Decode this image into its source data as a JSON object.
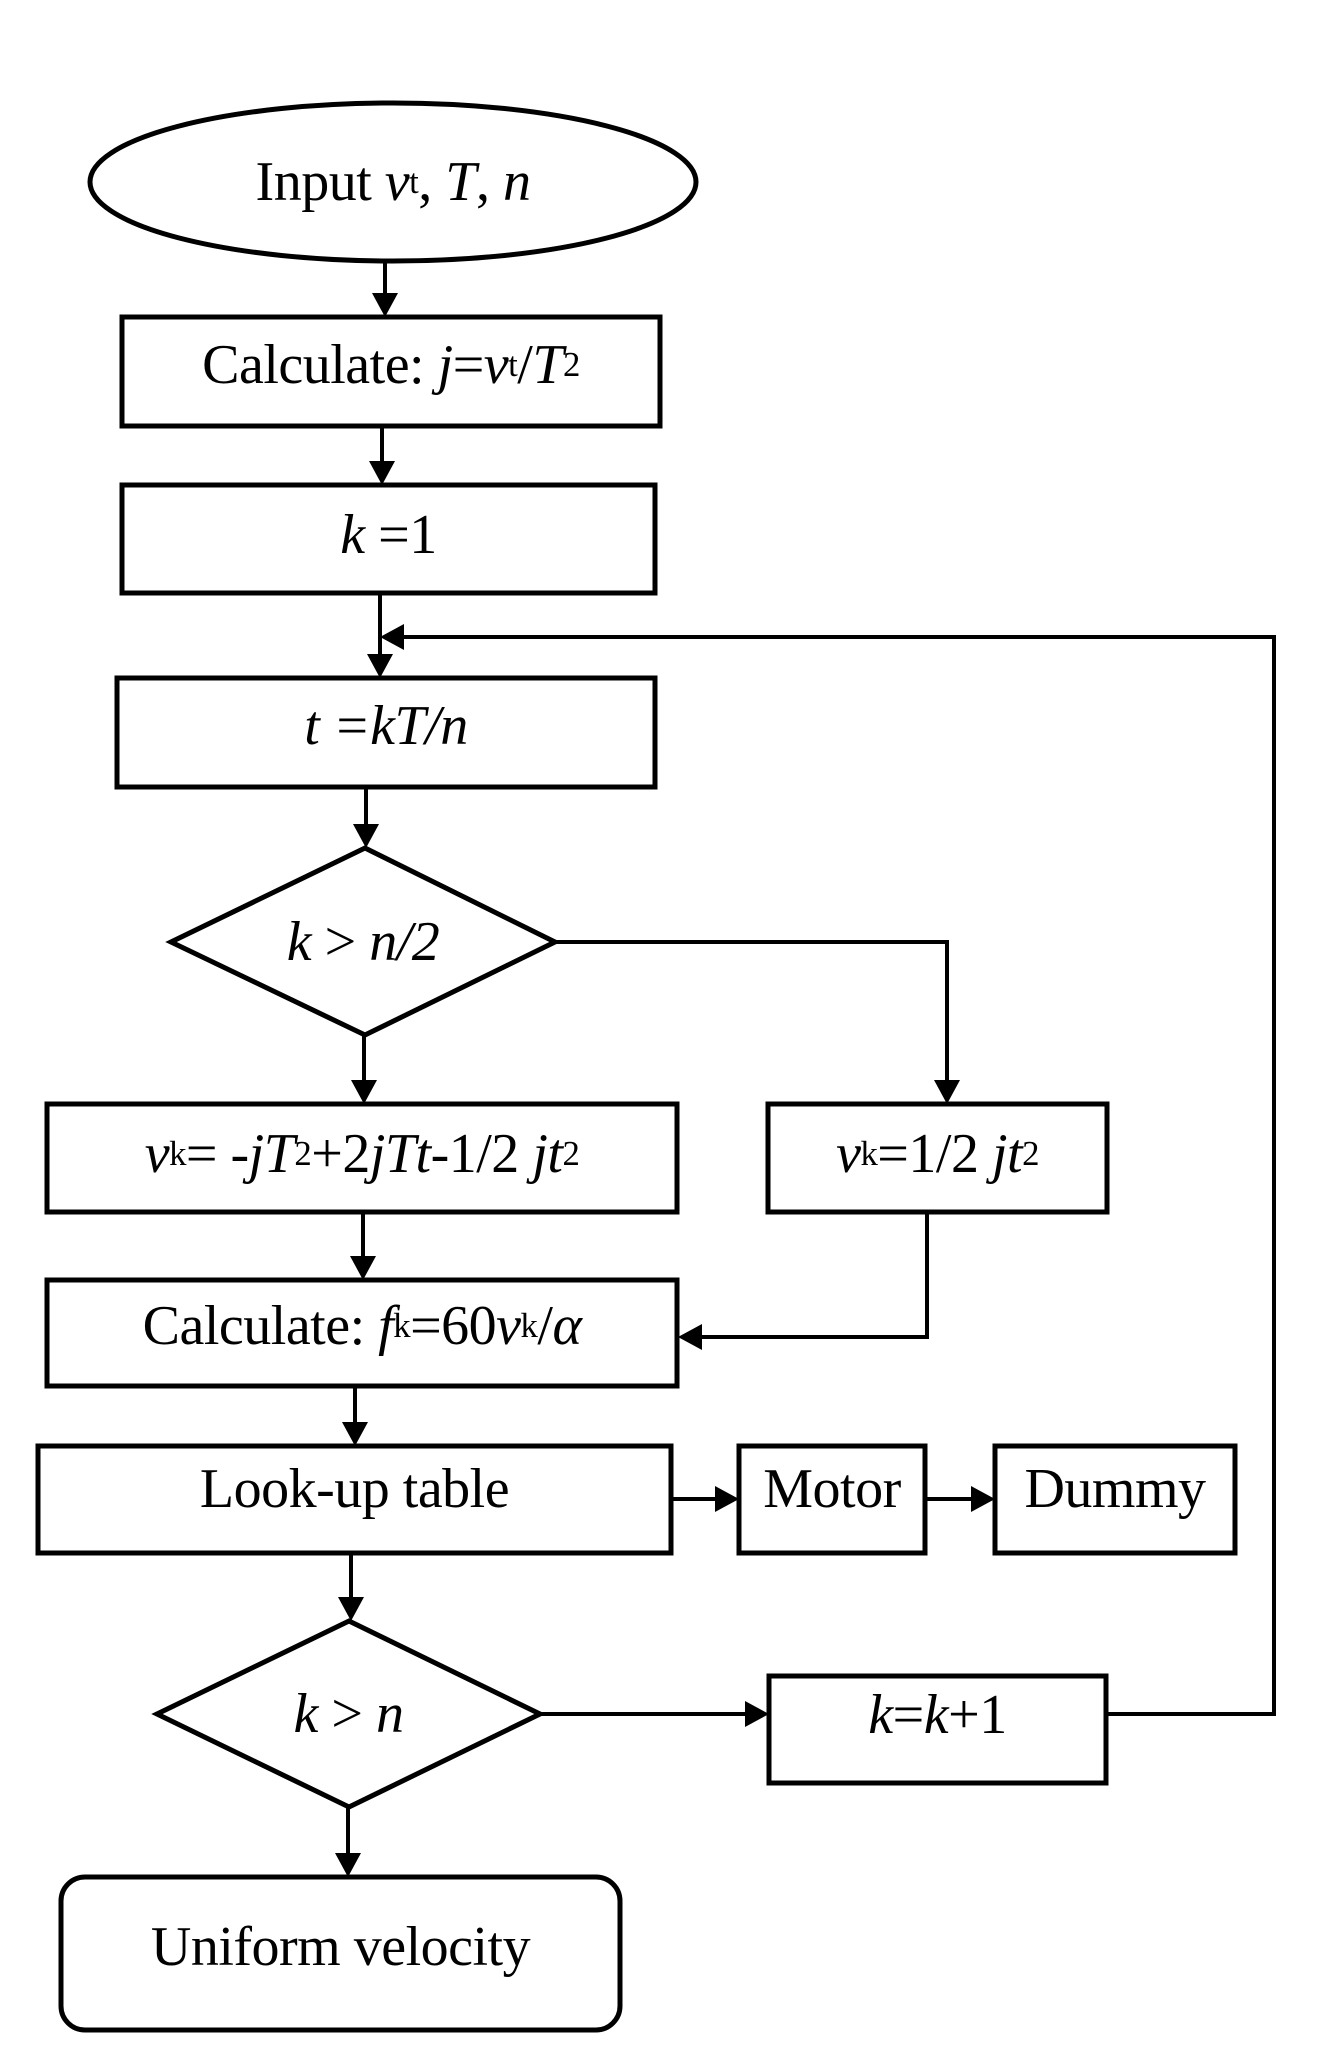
{
  "diagram": {
    "type": "flowchart",
    "colors": {
      "stroke": "#000000",
      "fill": "#ffffff",
      "text": "#000000"
    },
    "nodes": {
      "start": {
        "shape": "ellipse",
        "prefix": "Input ",
        "var1": "v",
        "var1_sub": "t",
        "sep1": ", ",
        "var2": "T",
        "sep2": ", ",
        "var3": "n"
      },
      "calc_j": {
        "shape": "rectangle",
        "prefix": "Calculate: ",
        "lhs": "j",
        "eq": "=",
        "v": "v",
        "v_sub": "t",
        "slash": "/",
        "T": "T",
        "exp": "2"
      },
      "init_k": {
        "shape": "rectangle",
        "k": "k",
        "rest": " =1"
      },
      "calc_t": {
        "shape": "rectangle",
        "text": "t =kT/n"
      },
      "decision_half": {
        "shape": "diamond",
        "k": "k",
        "op": " > ",
        "rhs": "n/2"
      },
      "vk_decel": {
        "shape": "rectangle",
        "v": "v",
        "v_sub": "k",
        "eq": "= ",
        "t1": "-jT",
        "e1": "2",
        "t2": "+2",
        "t3": "jTt",
        "t4": "-1/2 ",
        "t5": "jt",
        "e2": "2"
      },
      "vk_accel": {
        "shape": "rectangle",
        "v": "v",
        "v_sub": "k",
        "eq": "=1/2 ",
        "t1": "jt",
        "e1": "2"
      },
      "calc_f": {
        "shape": "rectangle",
        "prefix": "Calculate: ",
        "f": "f",
        "f_sub": "k",
        "eq": "=60",
        "v": "v",
        "v_sub": "k",
        "slash": "/",
        "alpha": "α"
      },
      "lookup": {
        "shape": "rectangle",
        "text": "Look-up table"
      },
      "motor": {
        "shape": "rectangle",
        "text": "Motor"
      },
      "dummy": {
        "shape": "rectangle",
        "text": "Dummy"
      },
      "decision_end": {
        "shape": "diamond",
        "k": "k",
        "op": " > ",
        "rhs": "n"
      },
      "increment": {
        "shape": "rectangle",
        "k1": "k",
        "eq": "=",
        "k2": "k",
        "rest": "+1"
      },
      "end": {
        "shape": "rounded-rectangle",
        "text": "Uniform velocity"
      }
    },
    "edges": [
      {
        "from": "start",
        "to": "calc_j"
      },
      {
        "from": "calc_j",
        "to": "init_k"
      },
      {
        "from": "init_k",
        "to": "calc_t"
      },
      {
        "from": "calc_t",
        "to": "decision_half"
      },
      {
        "from": "decision_half",
        "to": "vk_decel",
        "branch": "down"
      },
      {
        "from": "decision_half",
        "to": "vk_accel",
        "branch": "right"
      },
      {
        "from": "vk_decel",
        "to": "calc_f"
      },
      {
        "from": "vk_accel",
        "to": "calc_f"
      },
      {
        "from": "calc_f",
        "to": "lookup"
      },
      {
        "from": "lookup",
        "to": "motor"
      },
      {
        "from": "motor",
        "to": "dummy"
      },
      {
        "from": "lookup",
        "to": "decision_end"
      },
      {
        "from": "decision_end",
        "to": "increment",
        "branch": "right"
      },
      {
        "from": "increment",
        "to": "calc_t",
        "branch": "loop"
      },
      {
        "from": "decision_end",
        "to": "end",
        "branch": "down"
      }
    ]
  }
}
